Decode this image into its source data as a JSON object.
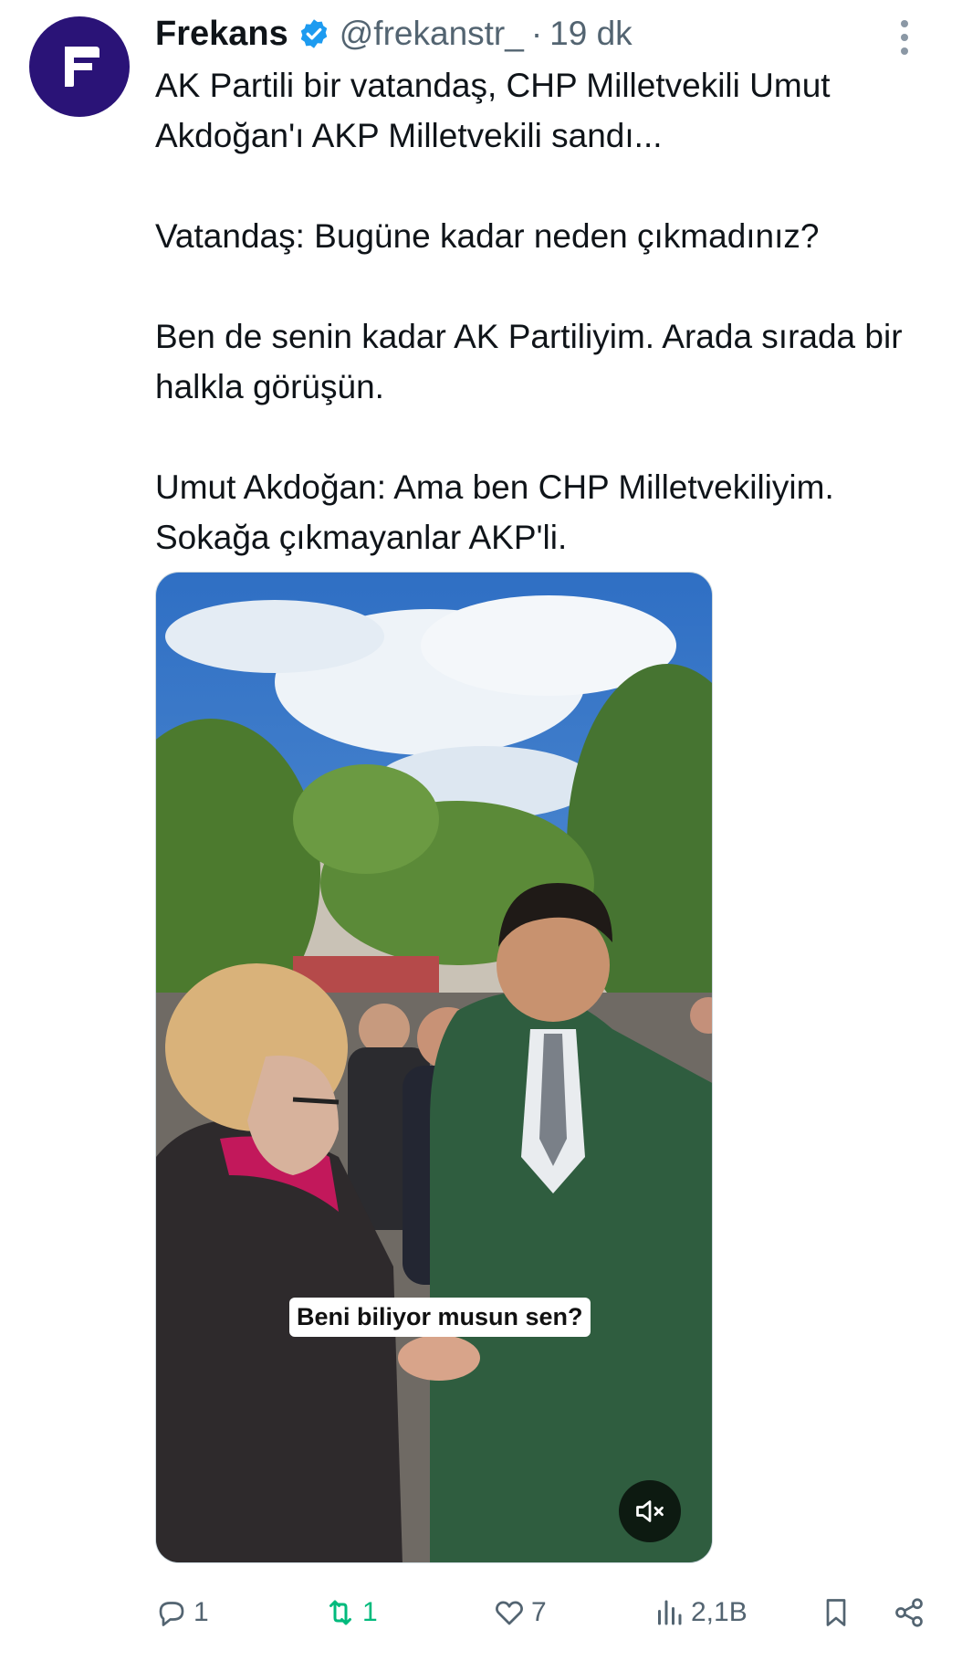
{
  "author": {
    "display_name": "Frekans",
    "handle": "@frekanstr_",
    "separator": "·",
    "time": "19 dk",
    "avatar_icon": "frekans-logo",
    "avatar_color": "#2a1377",
    "verified_color": "#1d9bf0"
  },
  "tweet": {
    "lines": [
      "AK Partili bir vatandaş, CHP Milletvekili Umut Akdoğan'ı AKP Milletvekili sandı...",
      "",
      "Vatandaş:  Bugüne kadar neden çıkmadınız?",
      "",
      "Ben de senin kadar AK Partiliyim. Arada sırada bir halkla görüşün.",
      "",
      "Umut Akdoğan: Ama ben CHP Milletvekiliyim. Sokağa çıkmayanlar AKP'li."
    ]
  },
  "media": {
    "caption": "Beni biliyor musun sen?",
    "mute_icon": "speaker-muted-icon"
  },
  "actions": {
    "reply_count": "1",
    "retweet_count": "1",
    "like_count": "7",
    "views_count": "2,1B",
    "retweet_color": "#00ba7c"
  }
}
